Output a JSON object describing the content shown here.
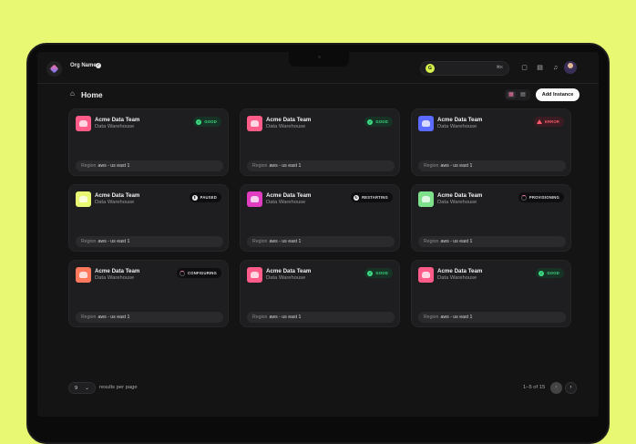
{
  "topbar": {
    "org_name": "Org Name",
    "search_shortcut": "⌘K",
    "search_avatar_letter": "G",
    "icons": [
      "chat-icon",
      "document-icon",
      "bell-icon"
    ]
  },
  "page": {
    "title": "Home",
    "add_button": "Add Instance"
  },
  "instances": [
    {
      "title": "Acme Data Team",
      "subtitle": "Data Warehouse",
      "status": "GOOD",
      "status_kind": "good",
      "region_label": "Region",
      "region": "aws - us east 1",
      "icon_color": "#ff5c8a"
    },
    {
      "title": "Acme Data Team",
      "subtitle": "Data Warehouse",
      "status": "GOOD",
      "status_kind": "good",
      "region_label": "Region",
      "region": "aws - us east 1",
      "icon_color": "#ff5c8a"
    },
    {
      "title": "Acme Data Team",
      "subtitle": "Data Warehouse",
      "status": "ERROR",
      "status_kind": "error",
      "region_label": "Region",
      "region": "aws - us east 1",
      "icon_color": "#5b6bff"
    },
    {
      "title": "Acme Data Team",
      "subtitle": "Data Warehouse",
      "status": "PAUSED",
      "status_kind": "paused",
      "region_label": "Region",
      "region": "aws - us east 1",
      "icon_color": "#e8f872"
    },
    {
      "title": "Acme Data Team",
      "subtitle": "Data Warehouse",
      "status": "RESTARTING",
      "status_kind": "restarting",
      "region_label": "Region",
      "region": "aws - us east 1",
      "icon_color": "#e13dc0"
    },
    {
      "title": "Acme Data Team",
      "subtitle": "Data Warehouse",
      "status": "PROVISIONING",
      "status_kind": "spin",
      "region_label": "Region",
      "region": "aws - us east 1",
      "icon_color": "#7ee08a"
    },
    {
      "title": "Acme Data Team",
      "subtitle": "Data Warehouse",
      "status": "CONFIGURING",
      "status_kind": "spin",
      "region_label": "Region",
      "region": "aws - us east 1",
      "icon_color": "#ff7a5c"
    },
    {
      "title": "Acme Data Team",
      "subtitle": "Data Warehouse",
      "status": "GOOD",
      "status_kind": "good",
      "region_label": "Region",
      "region": "aws - us east 1",
      "icon_color": "#ff5c8a"
    },
    {
      "title": "Acme Data Team",
      "subtitle": "Data Warehouse",
      "status": "GOOD",
      "status_kind": "good",
      "region_label": "Region",
      "region": "aws - us east 1",
      "icon_color": "#ff5c8a"
    }
  ],
  "pagination": {
    "per_page": "9",
    "per_page_label": "results per page",
    "count": "1–5 of 15",
    "prev": "‹",
    "next": "›"
  },
  "colors": {
    "background": "#e8f872",
    "screen": "#141415",
    "card": "#1e1e20",
    "good": "#3ddc84",
    "error": "#ff5a6e",
    "accent": "#ff7ab0"
  }
}
